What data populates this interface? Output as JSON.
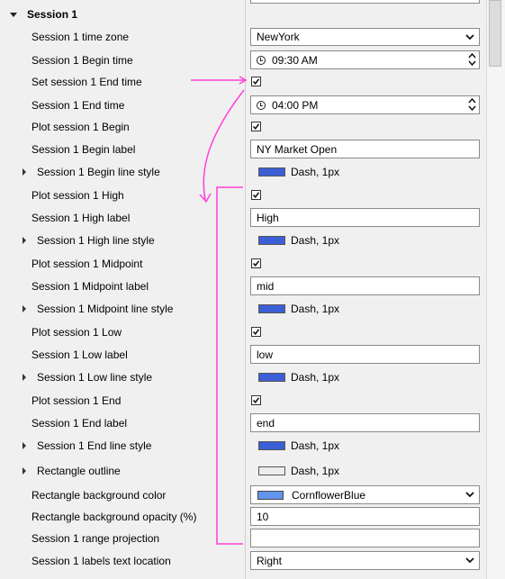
{
  "section": {
    "title": "Session 1",
    "expanded": true
  },
  "rows": {
    "time_zone": {
      "label": "Session 1 time zone",
      "value": "NewYork"
    },
    "begin_time": {
      "label": "Session 1 Begin time",
      "value": "09:30 AM"
    },
    "set_end": {
      "label": "Set session 1 End time",
      "checked": true
    },
    "end_time": {
      "label": "Session 1 End time",
      "value": "04:00 PM"
    },
    "plot_begin": {
      "label": "Plot session 1 Begin",
      "checked": true
    },
    "begin_label": {
      "label": "Session 1 Begin label",
      "value": "NY Market Open"
    },
    "begin_style": {
      "label": "Session 1 Begin line style",
      "value": "Dash, 1px",
      "color": "#3d5fd6"
    },
    "plot_high": {
      "label": "Plot session 1 High",
      "checked": true
    },
    "high_label": {
      "label": "Session 1 High label",
      "value": "High"
    },
    "high_style": {
      "label": "Session 1 High line style",
      "value": "Dash, 1px",
      "color": "#3d5fd6"
    },
    "plot_mid": {
      "label": "Plot session 1 Midpoint",
      "checked": true
    },
    "mid_label": {
      "label": "Session 1 Midpoint label",
      "value": "mid"
    },
    "mid_style": {
      "label": "Session 1 Midpoint line style",
      "value": "Dash, 1px",
      "color": "#3d5fd6"
    },
    "plot_low": {
      "label": "Plot session 1 Low",
      "checked": true
    },
    "low_label": {
      "label": "Session 1 Low label",
      "value": "low"
    },
    "low_style": {
      "label": "Session 1 Low line style",
      "value": "Dash, 1px",
      "color": "#3d5fd6"
    },
    "plot_end": {
      "label": "Plot session 1 End",
      "checked": true
    },
    "end_label": {
      "label": "Session 1 End label",
      "value": "end"
    },
    "end_style": {
      "label": "Session 1 End line style",
      "value": "Dash, 1px",
      "color": "#3d5fd6"
    },
    "rect_outline": {
      "label": "Rectangle outline",
      "value": "Dash, 1px",
      "color": "#ececec"
    },
    "rect_bg_color": {
      "label": "Rectangle background color",
      "value": "CornflowerBlue",
      "color": "#6495ed"
    },
    "rect_bg_opacity": {
      "label": "Rectangle background opacity (%)",
      "value": "10"
    },
    "range_projection": {
      "label": "Session 1 range projection",
      "value": ""
    },
    "labels_location": {
      "label": "Session 1 labels text location",
      "value": "Right"
    }
  },
  "colors": {
    "annotation": "#ff3fd8",
    "background": "#f0f0f0"
  }
}
